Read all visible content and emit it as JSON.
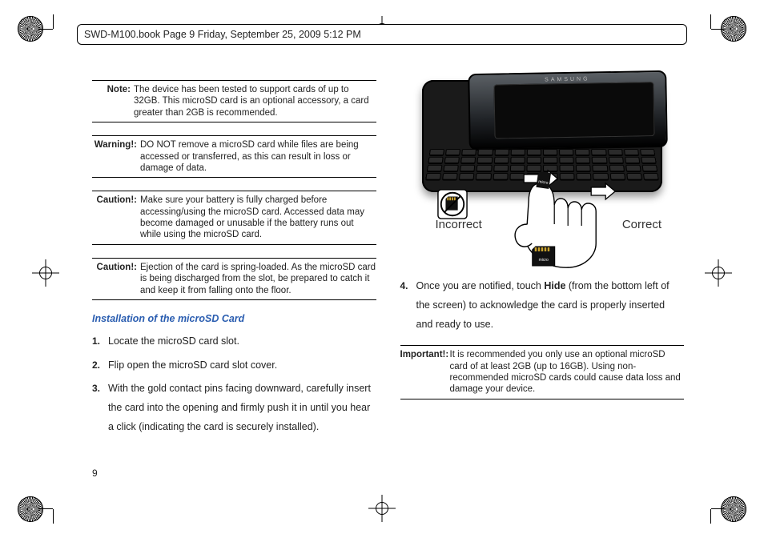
{
  "header": "SWD-M100.book  Page 9  Friday, September 25, 2009  5:12 PM",
  "page_number": "9",
  "left": {
    "note_label": "Note:",
    "note_text": "The device has been tested to support cards of up to 32GB. This microSD card is an optional accessory, a card greater than 2GB is recommended.",
    "warn_label": "Warning!:",
    "warn_text": "DO NOT remove a microSD card while files are being accessed or transferred, as this can result in loss or damage of data.",
    "caution1_label": "Caution!:",
    "caution1_text": "Make sure your battery is fully charged before accessing/using the microSD card. Accessed data may become damaged or unusable if the battery runs out while using the microSD card.",
    "caution2_label": "Caution!:",
    "caution2_text": "Ejection of the card is spring-loaded. As the microSD card is being discharged from the slot, be prepared to catch it and keep it from falling onto the floor.",
    "section_title": "Installation of the microSD Card",
    "steps": {
      "s1_num": "1.",
      "s1": "Locate the microSD card slot.",
      "s2_num": "2.",
      "s2": "Flip open the microSD card slot cover.",
      "s3_num": "3.",
      "s3": "With the gold contact pins facing downward, carefully insert the card into the opening and firmly push it in until you hear a click (indicating the card is securely installed)."
    }
  },
  "right": {
    "brand": "SAMSUNG",
    "incorrect": "Incorrect",
    "correct": "Correct",
    "step4_num": "4.",
    "step4_pre": "Once you are notified, touch ",
    "step4_bold": "Hide",
    "step4_post": " (from the bottom left of the screen) to acknowledge the card is properly inserted and ready to use.",
    "important_label": "Important!:",
    "important_text": "It is recommended you only use an optional microSD card of at least 2GB (up to 16GB). Using non-recommended microSD cards could cause data loss and damage your device."
  }
}
